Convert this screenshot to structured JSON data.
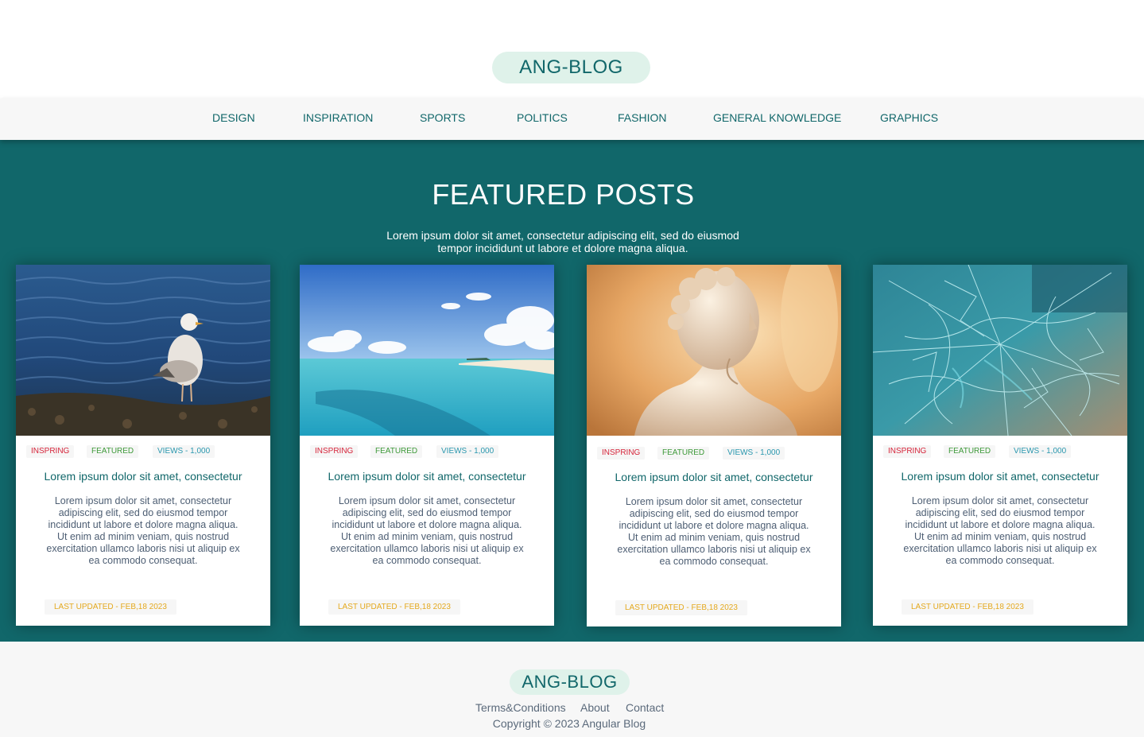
{
  "header": {
    "logo": "ANG-BLOG"
  },
  "nav": {
    "items": [
      {
        "label": "DESIGN"
      },
      {
        "label": "INSPIRATION"
      },
      {
        "label": "SPORTS"
      },
      {
        "label": "POLITICS"
      },
      {
        "label": "FASHION"
      },
      {
        "label": "GENERAL KNOWLEDGE"
      },
      {
        "label": "GRAPHICS"
      }
    ]
  },
  "featured": {
    "title": "FEATURED POSTS",
    "subtitle": "Lorem ipsum dolor sit amet, consectetur adipiscing elit, sed do eiusmod tempor incididunt ut labore et dolore magna aliqua."
  },
  "colors": {
    "primary": "#11676a",
    "pill": "#dff2ea",
    "tag_red": "#d6253b",
    "tag_green": "#3f9a3a",
    "tag_blue": "#2a97ae",
    "updated": "#e4a91f"
  },
  "cards": [
    {
      "image": "seagull-on-water-photo",
      "tags": [
        "INSPRING",
        "FEATURED",
        "VIEWS - 1,000"
      ],
      "title": "Lorem ipsum dolor sit amet, consectetur",
      "text": "Lorem ipsum dolor sit amet, consectetur adipiscing elit, sed do eiusmod tempor incididunt ut labore et dolore magna aliqua. Ut enim ad minim veniam, quis nostrud exercitation ullamco laboris nisi ut aliquip ex ea commodo consequat.",
      "updated": "LAST UPDATED - FEB,18 2023"
    },
    {
      "image": "tropical-beach-photo",
      "tags": [
        "INSPRING",
        "FEATURED",
        "VIEWS - 1,000"
      ],
      "title": "Lorem ipsum dolor sit amet, consectetur",
      "text": "Lorem ipsum dolor sit amet, consectetur adipiscing elit, sed do eiusmod tempor incididunt ut labore et dolore magna aliqua. Ut enim ad minim veniam, quis nostrud exercitation ullamco laboris nisi ut aliquip ex ea commodo consequat.",
      "updated": "LAST UPDATED - FEB,18 2023"
    },
    {
      "image": "statue-bust-photo",
      "tags": [
        "INSPRING",
        "FEATURED",
        "VIEWS - 1,000"
      ],
      "title": "Lorem ipsum dolor sit amet, consectetur",
      "text": "Lorem ipsum dolor sit amet, consectetur adipiscing elit, sed do eiusmod tempor incididunt ut labore et dolore magna aliqua. Ut enim ad minim veniam, quis nostrud exercitation ullamco laboris nisi ut aliquip ex ea commodo consequat.",
      "updated": "LAST UPDATED - FEB,18 2023"
    },
    {
      "image": "cracked-glass-photo",
      "tags": [
        "INSPRING",
        "FEATURED",
        "VIEWS - 1,000"
      ],
      "title": "Lorem ipsum dolor sit amet, consectetur",
      "text": "Lorem ipsum dolor sit amet, consectetur adipiscing elit, sed do eiusmod tempor incididunt ut labore et dolore magna aliqua. Ut enim ad minim veniam, quis nostrud exercitation ullamco laboris nisi ut aliquip ex ea commodo consequat.",
      "updated": "LAST UPDATED - FEB,18 2023"
    }
  ],
  "footer": {
    "logo": "ANG-BLOG",
    "links": [
      {
        "label": "Terms&Conditions"
      },
      {
        "label": "About"
      },
      {
        "label": "Contact"
      }
    ],
    "copyright": "Copyright © 2023 Angular Blog"
  }
}
